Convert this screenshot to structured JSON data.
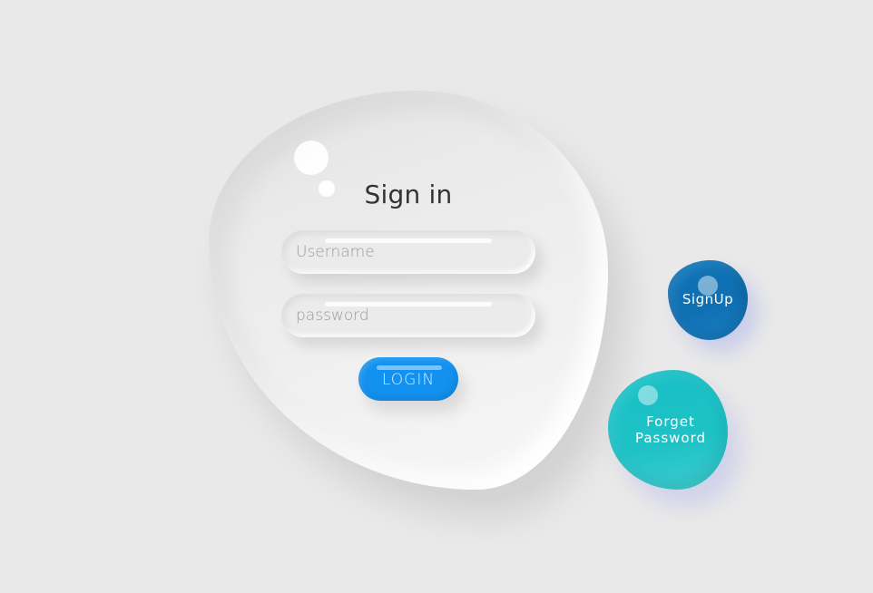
{
  "login_card": {
    "title": "Sign in",
    "username_placeholder": "Username",
    "password_placeholder": "password",
    "login_label": "LOGIN"
  },
  "side_actions": {
    "signup_label": "SignUp",
    "forget_label": "Forget\nPassword"
  },
  "colors": {
    "background": "#e9e9e9",
    "login_button": "#1391f0",
    "signup_button": "#0e74b8",
    "forget_button": "#18bfc6",
    "title_text": "#333333"
  },
  "icons": [
    "bubble-decoration-icon"
  ]
}
